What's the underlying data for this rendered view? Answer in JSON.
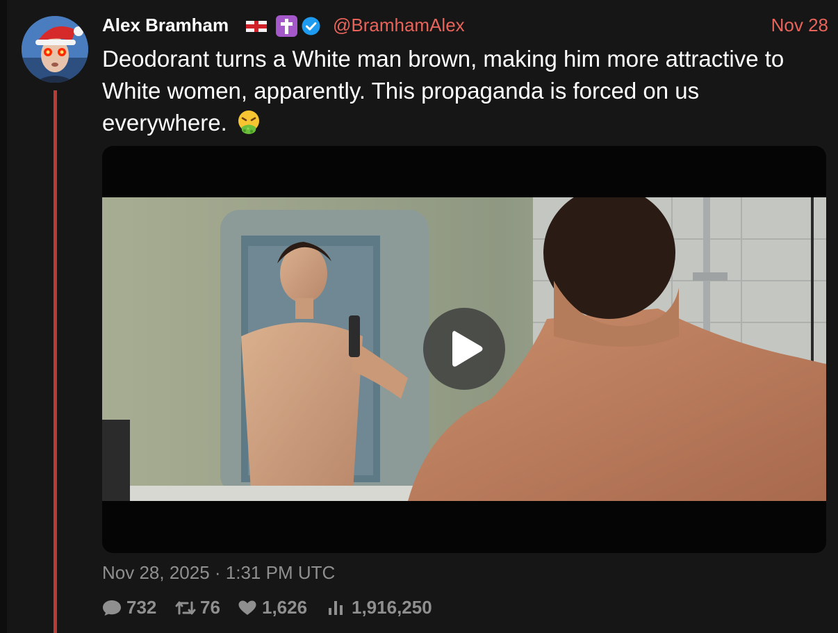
{
  "post": {
    "author": {
      "name": "Alex Bramham",
      "handle": "@BramhamAlex"
    },
    "date_short": "Nov 28",
    "text": "Deodorant turns a White man brown, making him more attractive to White women, apparently. This propaganda is forced on us everywhere.",
    "media": {
      "type": "video",
      "play_icon": "play-icon"
    },
    "timestamp": "Nov 28, 2025 · 1:31 PM UTC",
    "stats": {
      "replies": "732",
      "retweets": "76",
      "likes": "1,626",
      "views": "1,916,250"
    }
  },
  "colors": {
    "background": "#161616",
    "accent": "#e8645a",
    "thread_line": "#b73c36",
    "muted_text": "#8f8f8f",
    "verified": "#1d9bf0"
  },
  "icons": {
    "reply": "comment-icon",
    "retweet": "retweet-icon",
    "like": "heart-icon",
    "views": "bar-chart-icon",
    "verified": "verified-badge-icon",
    "flag": "england-flag-icon",
    "cross": "latin-cross-icon",
    "emoji": "vomiting-face-emoji"
  }
}
